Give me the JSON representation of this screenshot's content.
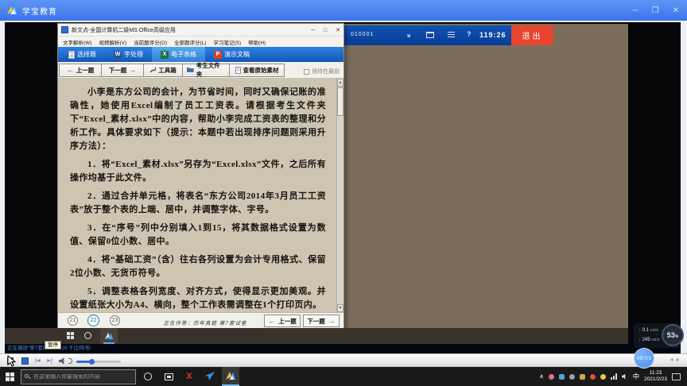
{
  "player": {
    "title": "学宝教育",
    "controls": {
      "minimize": "─",
      "maximize": "❐",
      "close": "✕"
    }
  },
  "video": {
    "exam_bar": {
      "candidate_id": "010001",
      "timer": "119:26",
      "exit_label": "退出",
      "help": "?"
    },
    "app_window": {
      "title": "新文点-全国计算机二级MS Office高级应用",
      "controls": {
        "minimize": "─",
        "maximize": "□",
        "close": "✕"
      },
      "menu": [
        "文字解析(W)",
        "视频解析(V)",
        "当前题评分(O)",
        "全部题评分(L)",
        "学习笔记(S)",
        "帮助(H)"
      ],
      "tabs": [
        {
          "label": "选择题",
          "icon": "document-icon",
          "selected": false
        },
        {
          "label": "字处理",
          "icon": "word-icon",
          "selected": false
        },
        {
          "label": "电子表格",
          "icon": "excel-icon",
          "selected": true
        },
        {
          "label": "演示文稿",
          "icon": "powerpoint-icon",
          "selected": false
        }
      ],
      "tab_icon_letters": {
        "word": "W",
        "excel": "X",
        "ppt": "P"
      },
      "toolbar": {
        "prev": "上一题",
        "next": "下一题",
        "toolbox": "工具箱",
        "folder": "考生文件夹",
        "view_material": "查看原始素材",
        "keep_on_top": "保持在最前"
      },
      "content": {
        "paragraphs": [
          "小李是东方公司的会计，为节省时间，同时又确保记账的准确性，她使用Excel编制了员工工资表。请根据考生文件夹下“Excel_素材.xlsx”中的内容，帮助小李完成工资表的整理和分析工作。具体要求如下（提示：本题中若出现排序问题则采用升序方法）：",
          "1．将“Excel_素材.xlsx”另存为“Excel.xlsx”文件，之后所有操作均基于此文件。",
          "2．通过合并单元格，将表名“东方公司2014年3月员工工资表”放于整个表的上端、居中，并调整字体、字号。",
          "3．在“序号”列中分别填入1到15，将其数据格式设置为数值、保留0位小数、居中。",
          "4．将“基础工资”（含）往右各列设置为会计专用格式、保留2位小数、无货币符号。",
          "5．调整表格各列宽度、对齐方式，使得显示更加美观。并设置纸张大小为A4、横向，整个工作表需调整在1个打印页内。"
        ]
      },
      "footer": {
        "pages": [
          "21",
          "22",
          "23"
        ],
        "current_page": "22",
        "status": "正在作答：历年真题 第7套试卷",
        "prev": "上一题",
        "next": "下一题"
      }
    },
    "network_overlay": {
      "up_value": "0.1",
      "down_value": "245",
      "unit": "KB/S",
      "percent": "53",
      "percent_sign": "%"
    }
  },
  "player_controls": {
    "status_text": "正在播放“第7套Excel”  416 千比特/秒",
    "pause_tooltip": "暂停",
    "time_bubble": "00:03",
    "more": "∗∗"
  },
  "taskbar": {
    "search_placeholder": "在这里输入你要搜索的内容",
    "ime_indicator": "中",
    "time": "11:23",
    "date": "2021/2/23"
  },
  "colors": {
    "player_titlebar_blue": "#3f7ef0",
    "exam_bar_blue": "#0d47a1",
    "exit_red": "#e8442e",
    "app_tab_blue": "#1a6fd0",
    "content_beige": "#cdc4b2",
    "wallpaper_brown": "#7b6d5c",
    "status_text_blue": "#4a7fd4"
  }
}
